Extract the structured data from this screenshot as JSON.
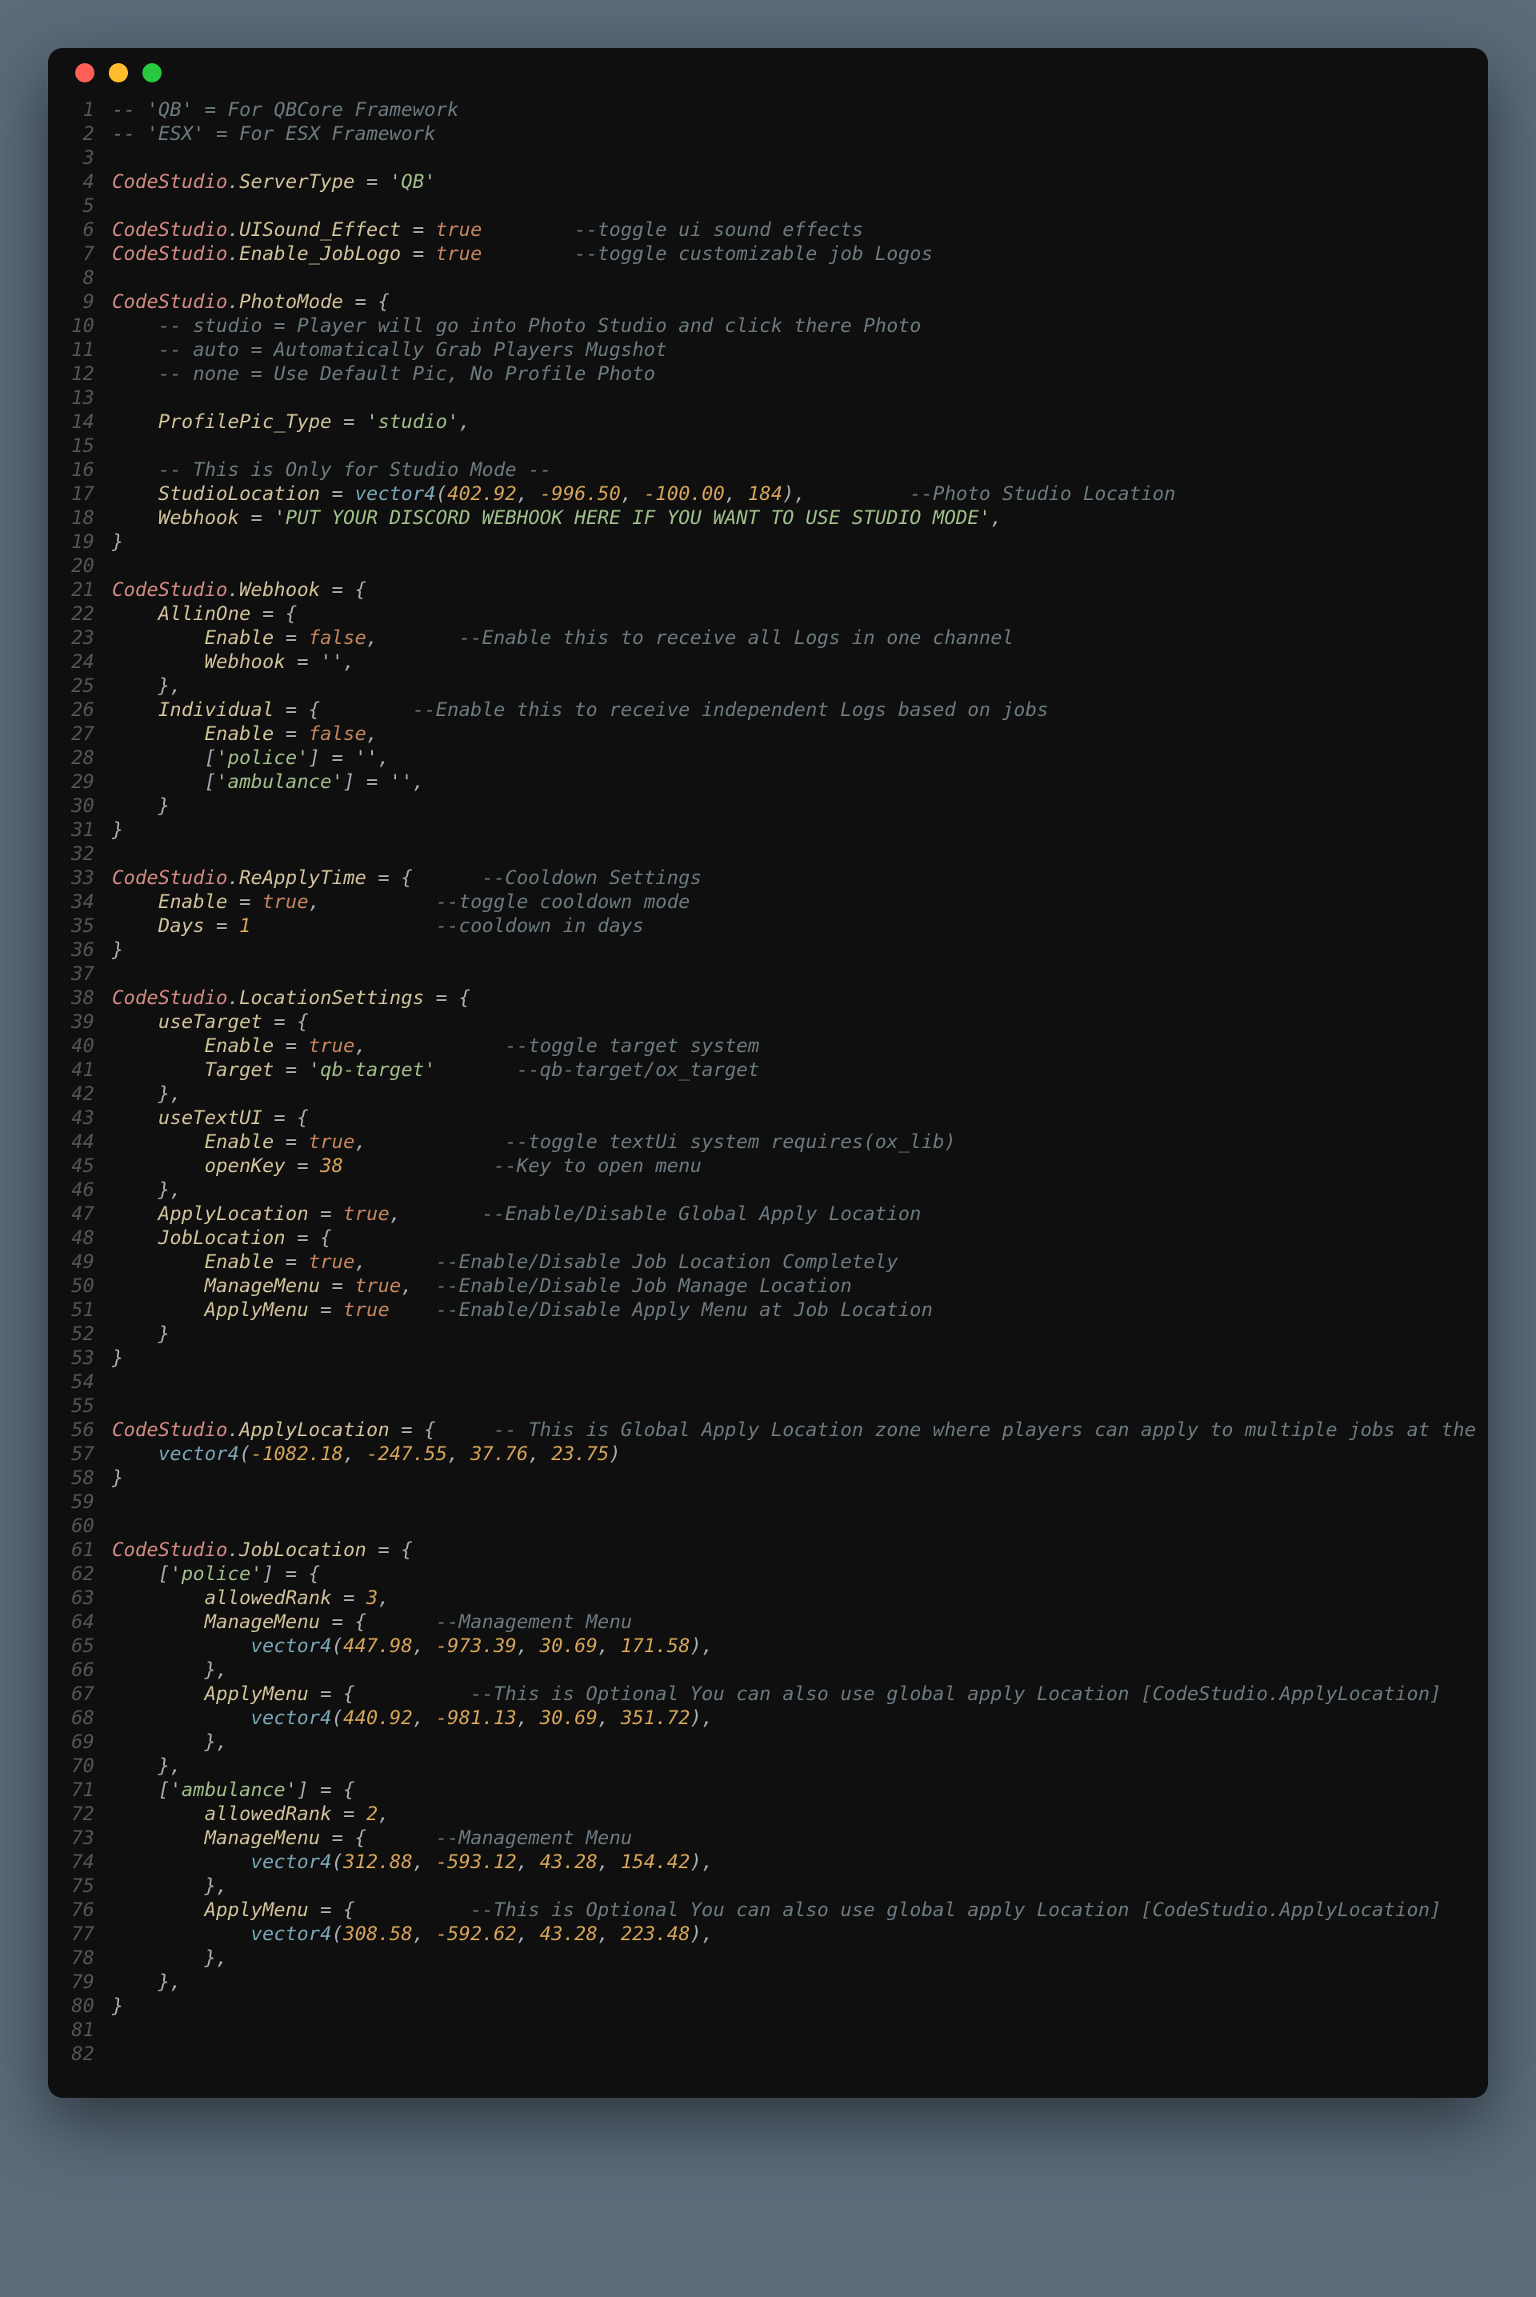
{
  "window": {
    "title": ""
  },
  "lines": [
    [
      [
        "c-comment",
        "-- 'QB' = For QBCore Framework"
      ]
    ],
    [
      [
        "c-comment",
        "-- 'ESX' = For ESX Framework"
      ]
    ],
    [],
    [
      [
        "c-ident",
        "CodeStudio"
      ],
      [
        "c-punct",
        "."
      ],
      [
        "c-prop",
        "ServerType"
      ],
      [
        "c-punct",
        " = "
      ],
      [
        "c-string",
        "'QB'"
      ]
    ],
    [],
    [
      [
        "c-ident",
        "CodeStudio"
      ],
      [
        "c-punct",
        "."
      ],
      [
        "c-prop",
        "UISound_Effect"
      ],
      [
        "c-punct",
        " = "
      ],
      [
        "c-bool",
        "true"
      ],
      [
        "",
        "        "
      ],
      [
        "c-comment",
        "--toggle ui sound effects"
      ]
    ],
    [
      [
        "c-ident",
        "CodeStudio"
      ],
      [
        "c-punct",
        "."
      ],
      [
        "c-prop",
        "Enable_JobLogo"
      ],
      [
        "c-punct",
        " = "
      ],
      [
        "c-bool",
        "true"
      ],
      [
        "",
        "        "
      ],
      [
        "c-comment",
        "--toggle customizable job Logos"
      ]
    ],
    [],
    [
      [
        "c-ident",
        "CodeStudio"
      ],
      [
        "c-punct",
        "."
      ],
      [
        "c-prop",
        "PhotoMode"
      ],
      [
        "c-punct",
        " = {"
      ]
    ],
    [
      [
        "",
        "    "
      ],
      [
        "c-comment",
        "-- studio = Player will go into Photo Studio and click there Photo"
      ]
    ],
    [
      [
        "",
        "    "
      ],
      [
        "c-comment",
        "-- auto = Automatically Grab Players Mugshot"
      ]
    ],
    [
      [
        "",
        "    "
      ],
      [
        "c-comment",
        "-- none = Use Default Pic, No Profile Photo"
      ]
    ],
    [],
    [
      [
        "",
        "    "
      ],
      [
        "c-prop",
        "ProfilePic_Type"
      ],
      [
        "c-punct",
        " = "
      ],
      [
        "c-string",
        "'studio'"
      ],
      [
        "c-punct",
        ","
      ]
    ],
    [],
    [
      [
        "",
        "    "
      ],
      [
        "c-comment",
        "-- This is Only for Studio Mode --"
      ]
    ],
    [
      [
        "",
        "    "
      ],
      [
        "c-prop",
        "StudioLocation"
      ],
      [
        "c-punct",
        " = "
      ],
      [
        "c-func",
        "vector4"
      ],
      [
        "c-punct",
        "("
      ],
      [
        "c-num",
        "402.92"
      ],
      [
        "c-punct",
        ", "
      ],
      [
        "c-num",
        "-996.50"
      ],
      [
        "c-punct",
        ", "
      ],
      [
        "c-num",
        "-100.00"
      ],
      [
        "c-punct",
        ", "
      ],
      [
        "c-num",
        "184"
      ],
      [
        "c-punct",
        "),         "
      ],
      [
        "c-comment",
        "--Photo Studio Location"
      ]
    ],
    [
      [
        "",
        "    "
      ],
      [
        "c-prop",
        "Webhook"
      ],
      [
        "c-punct",
        " = "
      ],
      [
        "c-string",
        "'PUT YOUR DISCORD WEBHOOK HERE IF YOU WANT TO USE STUDIO MODE'"
      ],
      [
        "c-punct",
        ","
      ]
    ],
    [
      [
        "c-punct",
        "}"
      ]
    ],
    [],
    [
      [
        "c-ident",
        "CodeStudio"
      ],
      [
        "c-punct",
        "."
      ],
      [
        "c-prop",
        "Webhook"
      ],
      [
        "c-punct",
        " = {"
      ]
    ],
    [
      [
        "",
        "    "
      ],
      [
        "c-prop",
        "AllinOne"
      ],
      [
        "c-punct",
        " = {"
      ]
    ],
    [
      [
        "",
        "        "
      ],
      [
        "c-prop",
        "Enable"
      ],
      [
        "c-punct",
        " = "
      ],
      [
        "c-bool",
        "false"
      ],
      [
        "c-punct",
        ",       "
      ],
      [
        "c-comment",
        "--Enable this to receive all Logs in one channel"
      ]
    ],
    [
      [
        "",
        "        "
      ],
      [
        "c-prop",
        "Webhook"
      ],
      [
        "c-punct",
        " = "
      ],
      [
        "c-string",
        "''"
      ],
      [
        "c-punct",
        ","
      ]
    ],
    [
      [
        "",
        "    "
      ],
      [
        "c-punct",
        "},"
      ]
    ],
    [
      [
        "",
        "    "
      ],
      [
        "c-prop",
        "Individual"
      ],
      [
        "c-punct",
        " = {        "
      ],
      [
        "c-comment",
        "--Enable this to receive independent Logs based on jobs"
      ]
    ],
    [
      [
        "",
        "        "
      ],
      [
        "c-prop",
        "Enable"
      ],
      [
        "c-punct",
        " = "
      ],
      [
        "c-bool",
        "false"
      ],
      [
        "c-punct",
        ","
      ]
    ],
    [
      [
        "",
        "        "
      ],
      [
        "c-punct",
        "["
      ],
      [
        "c-key",
        "'police'"
      ],
      [
        "c-punct",
        "] = "
      ],
      [
        "c-string",
        "''"
      ],
      [
        "c-punct",
        ","
      ]
    ],
    [
      [
        "",
        "        "
      ],
      [
        "c-punct",
        "["
      ],
      [
        "c-key",
        "'ambulance'"
      ],
      [
        "c-punct",
        "] = "
      ],
      [
        "c-string",
        "''"
      ],
      [
        "c-punct",
        ","
      ]
    ],
    [
      [
        "",
        "    "
      ],
      [
        "c-punct",
        "}"
      ]
    ],
    [
      [
        "c-punct",
        "}"
      ]
    ],
    [],
    [
      [
        "c-ident",
        "CodeStudio"
      ],
      [
        "c-punct",
        "."
      ],
      [
        "c-prop",
        "ReApplyTime"
      ],
      [
        "c-punct",
        " = {      "
      ],
      [
        "c-comment",
        "--Cooldown Settings"
      ]
    ],
    [
      [
        "",
        "    "
      ],
      [
        "c-prop",
        "Enable"
      ],
      [
        "c-punct",
        " = "
      ],
      [
        "c-bool",
        "true"
      ],
      [
        "c-punct",
        ",          "
      ],
      [
        "c-comment",
        "--toggle cooldown mode"
      ]
    ],
    [
      [
        "",
        "    "
      ],
      [
        "c-prop",
        "Days"
      ],
      [
        "c-punct",
        " = "
      ],
      [
        "c-num",
        "1"
      ],
      [
        "",
        "                "
      ],
      [
        "c-comment",
        "--cooldown in days"
      ]
    ],
    [
      [
        "c-punct",
        "}"
      ]
    ],
    [],
    [
      [
        "c-ident",
        "CodeStudio"
      ],
      [
        "c-punct",
        "."
      ],
      [
        "c-prop",
        "LocationSettings"
      ],
      [
        "c-punct",
        " = {"
      ]
    ],
    [
      [
        "",
        "    "
      ],
      [
        "c-prop",
        "useTarget"
      ],
      [
        "c-punct",
        " = {"
      ]
    ],
    [
      [
        "",
        "        "
      ],
      [
        "c-prop",
        "Enable"
      ],
      [
        "c-punct",
        " = "
      ],
      [
        "c-bool",
        "true"
      ],
      [
        "c-punct",
        ",            "
      ],
      [
        "c-comment",
        "--toggle target system"
      ]
    ],
    [
      [
        "",
        "        "
      ],
      [
        "c-prop",
        "Target"
      ],
      [
        "c-punct",
        " = "
      ],
      [
        "c-string",
        "'qb-target'"
      ],
      [
        "",
        "       "
      ],
      [
        "c-comment",
        "--qb-target/ox_target"
      ]
    ],
    [
      [
        "",
        "    "
      ],
      [
        "c-punct",
        "},"
      ]
    ],
    [
      [
        "",
        "    "
      ],
      [
        "c-prop",
        "useTextUI"
      ],
      [
        "c-punct",
        " = {"
      ]
    ],
    [
      [
        "",
        "        "
      ],
      [
        "c-prop",
        "Enable"
      ],
      [
        "c-punct",
        " = "
      ],
      [
        "c-bool",
        "true"
      ],
      [
        "c-punct",
        ",            "
      ],
      [
        "c-comment",
        "--toggle textUi system requires(ox_lib)"
      ]
    ],
    [
      [
        "",
        "        "
      ],
      [
        "c-prop",
        "openKey"
      ],
      [
        "c-punct",
        " = "
      ],
      [
        "c-num",
        "38"
      ],
      [
        "",
        "             "
      ],
      [
        "c-comment",
        "--Key to open menu"
      ]
    ],
    [
      [
        "",
        "    "
      ],
      [
        "c-punct",
        "},"
      ]
    ],
    [
      [
        "",
        "    "
      ],
      [
        "c-prop",
        "ApplyLocation"
      ],
      [
        "c-punct",
        " = "
      ],
      [
        "c-bool",
        "true"
      ],
      [
        "c-punct",
        ",       "
      ],
      [
        "c-comment",
        "--Enable/Disable Global Apply Location"
      ]
    ],
    [
      [
        "",
        "    "
      ],
      [
        "c-prop",
        "JobLocation"
      ],
      [
        "c-punct",
        " = {"
      ]
    ],
    [
      [
        "",
        "        "
      ],
      [
        "c-prop",
        "Enable"
      ],
      [
        "c-punct",
        " = "
      ],
      [
        "c-bool",
        "true"
      ],
      [
        "c-punct",
        ",      "
      ],
      [
        "c-comment",
        "--Enable/Disable Job Location Completely"
      ]
    ],
    [
      [
        "",
        "        "
      ],
      [
        "c-prop",
        "ManageMenu"
      ],
      [
        "c-punct",
        " = "
      ],
      [
        "c-bool",
        "true"
      ],
      [
        "c-punct",
        ",  "
      ],
      [
        "c-comment",
        "--Enable/Disable Job Manage Location"
      ]
    ],
    [
      [
        "",
        "        "
      ],
      [
        "c-prop",
        "ApplyMenu"
      ],
      [
        "c-punct",
        " = "
      ],
      [
        "c-bool",
        "true"
      ],
      [
        "",
        "    "
      ],
      [
        "c-comment",
        "--Enable/Disable Apply Menu at Job Location"
      ]
    ],
    [
      [
        "",
        "    "
      ],
      [
        "c-punct",
        "}"
      ]
    ],
    [
      [
        "c-punct",
        "}"
      ]
    ],
    [],
    [],
    [
      [
        "c-ident",
        "CodeStudio"
      ],
      [
        "c-punct",
        "."
      ],
      [
        "c-prop",
        "ApplyLocation"
      ],
      [
        "c-punct",
        " = {     "
      ],
      [
        "c-comment",
        "-- This is Global Apply Location zone where players can apply to multiple jobs at the same time"
      ]
    ],
    [
      [
        "",
        "    "
      ],
      [
        "c-func",
        "vector4"
      ],
      [
        "c-punct",
        "("
      ],
      [
        "c-num",
        "-1082.18"
      ],
      [
        "c-punct",
        ", "
      ],
      [
        "c-num",
        "-247.55"
      ],
      [
        "c-punct",
        ", "
      ],
      [
        "c-num",
        "37.76"
      ],
      [
        "c-punct",
        ", "
      ],
      [
        "c-num",
        "23.75"
      ],
      [
        "c-punct",
        ")"
      ]
    ],
    [
      [
        "c-punct",
        "}"
      ]
    ],
    [],
    [],
    [
      [
        "c-ident",
        "CodeStudio"
      ],
      [
        "c-punct",
        "."
      ],
      [
        "c-prop",
        "JobLocation"
      ],
      [
        "c-punct",
        " = {"
      ]
    ],
    [
      [
        "",
        "    "
      ],
      [
        "c-punct",
        "["
      ],
      [
        "c-key",
        "'police'"
      ],
      [
        "c-punct",
        "] = {"
      ]
    ],
    [
      [
        "",
        "        "
      ],
      [
        "c-prop",
        "allowedRank"
      ],
      [
        "c-punct",
        " = "
      ],
      [
        "c-num",
        "3"
      ],
      [
        "c-punct",
        ","
      ]
    ],
    [
      [
        "",
        "        "
      ],
      [
        "c-prop",
        "ManageMenu"
      ],
      [
        "c-punct",
        " = {      "
      ],
      [
        "c-comment",
        "--Management Menu"
      ]
    ],
    [
      [
        "",
        "            "
      ],
      [
        "c-func",
        "vector4"
      ],
      [
        "c-punct",
        "("
      ],
      [
        "c-num",
        "447.98"
      ],
      [
        "c-punct",
        ", "
      ],
      [
        "c-num",
        "-973.39"
      ],
      [
        "c-punct",
        ", "
      ],
      [
        "c-num",
        "30.69"
      ],
      [
        "c-punct",
        ", "
      ],
      [
        "c-num",
        "171.58"
      ],
      [
        "c-punct",
        "),"
      ]
    ],
    [
      [
        "",
        "        "
      ],
      [
        "c-punct",
        "},"
      ]
    ],
    [
      [
        "",
        "        "
      ],
      [
        "c-prop",
        "ApplyMenu"
      ],
      [
        "c-punct",
        " = {          "
      ],
      [
        "c-comment",
        "--This is Optional You can also use global apply Location [CodeStudio.ApplyLocation]"
      ]
    ],
    [
      [
        "",
        "            "
      ],
      [
        "c-func",
        "vector4"
      ],
      [
        "c-punct",
        "("
      ],
      [
        "c-num",
        "440.92"
      ],
      [
        "c-punct",
        ", "
      ],
      [
        "c-num",
        "-981.13"
      ],
      [
        "c-punct",
        ", "
      ],
      [
        "c-num",
        "30.69"
      ],
      [
        "c-punct",
        ", "
      ],
      [
        "c-num",
        "351.72"
      ],
      [
        "c-punct",
        "),"
      ]
    ],
    [
      [
        "",
        "        "
      ],
      [
        "c-punct",
        "},"
      ]
    ],
    [
      [
        "",
        "    "
      ],
      [
        "c-punct",
        "},"
      ]
    ],
    [
      [
        "",
        "    "
      ],
      [
        "c-punct",
        "["
      ],
      [
        "c-key",
        "'ambulance'"
      ],
      [
        "c-punct",
        "] = {"
      ]
    ],
    [
      [
        "",
        "        "
      ],
      [
        "c-prop",
        "allowedRank"
      ],
      [
        "c-punct",
        " = "
      ],
      [
        "c-num",
        "2"
      ],
      [
        "c-punct",
        ","
      ]
    ],
    [
      [
        "",
        "        "
      ],
      [
        "c-prop",
        "ManageMenu"
      ],
      [
        "c-punct",
        " = {      "
      ],
      [
        "c-comment",
        "--Management Menu"
      ]
    ],
    [
      [
        "",
        "            "
      ],
      [
        "c-func",
        "vector4"
      ],
      [
        "c-punct",
        "("
      ],
      [
        "c-num",
        "312.88"
      ],
      [
        "c-punct",
        ", "
      ],
      [
        "c-num",
        "-593.12"
      ],
      [
        "c-punct",
        ", "
      ],
      [
        "c-num",
        "43.28"
      ],
      [
        "c-punct",
        ", "
      ],
      [
        "c-num",
        "154.42"
      ],
      [
        "c-punct",
        "),"
      ]
    ],
    [
      [
        "",
        "        "
      ],
      [
        "c-punct",
        "},"
      ]
    ],
    [
      [
        "",
        "        "
      ],
      [
        "c-prop",
        "ApplyMenu"
      ],
      [
        "c-punct",
        " = {          "
      ],
      [
        "c-comment",
        "--This is Optional You can also use global apply Location [CodeStudio.ApplyLocation]"
      ]
    ],
    [
      [
        "",
        "            "
      ],
      [
        "c-func",
        "vector4"
      ],
      [
        "c-punct",
        "("
      ],
      [
        "c-num",
        "308.58"
      ],
      [
        "c-punct",
        ", "
      ],
      [
        "c-num",
        "-592.62"
      ],
      [
        "c-punct",
        ", "
      ],
      [
        "c-num",
        "43.28"
      ],
      [
        "c-punct",
        ", "
      ],
      [
        "c-num",
        "223.48"
      ],
      [
        "c-punct",
        "),"
      ]
    ],
    [
      [
        "",
        "        "
      ],
      [
        "c-punct",
        "},"
      ]
    ],
    [
      [
        "",
        "    "
      ],
      [
        "c-punct",
        "},"
      ]
    ],
    [
      [
        "c-punct",
        "}"
      ]
    ],
    [],
    []
  ]
}
